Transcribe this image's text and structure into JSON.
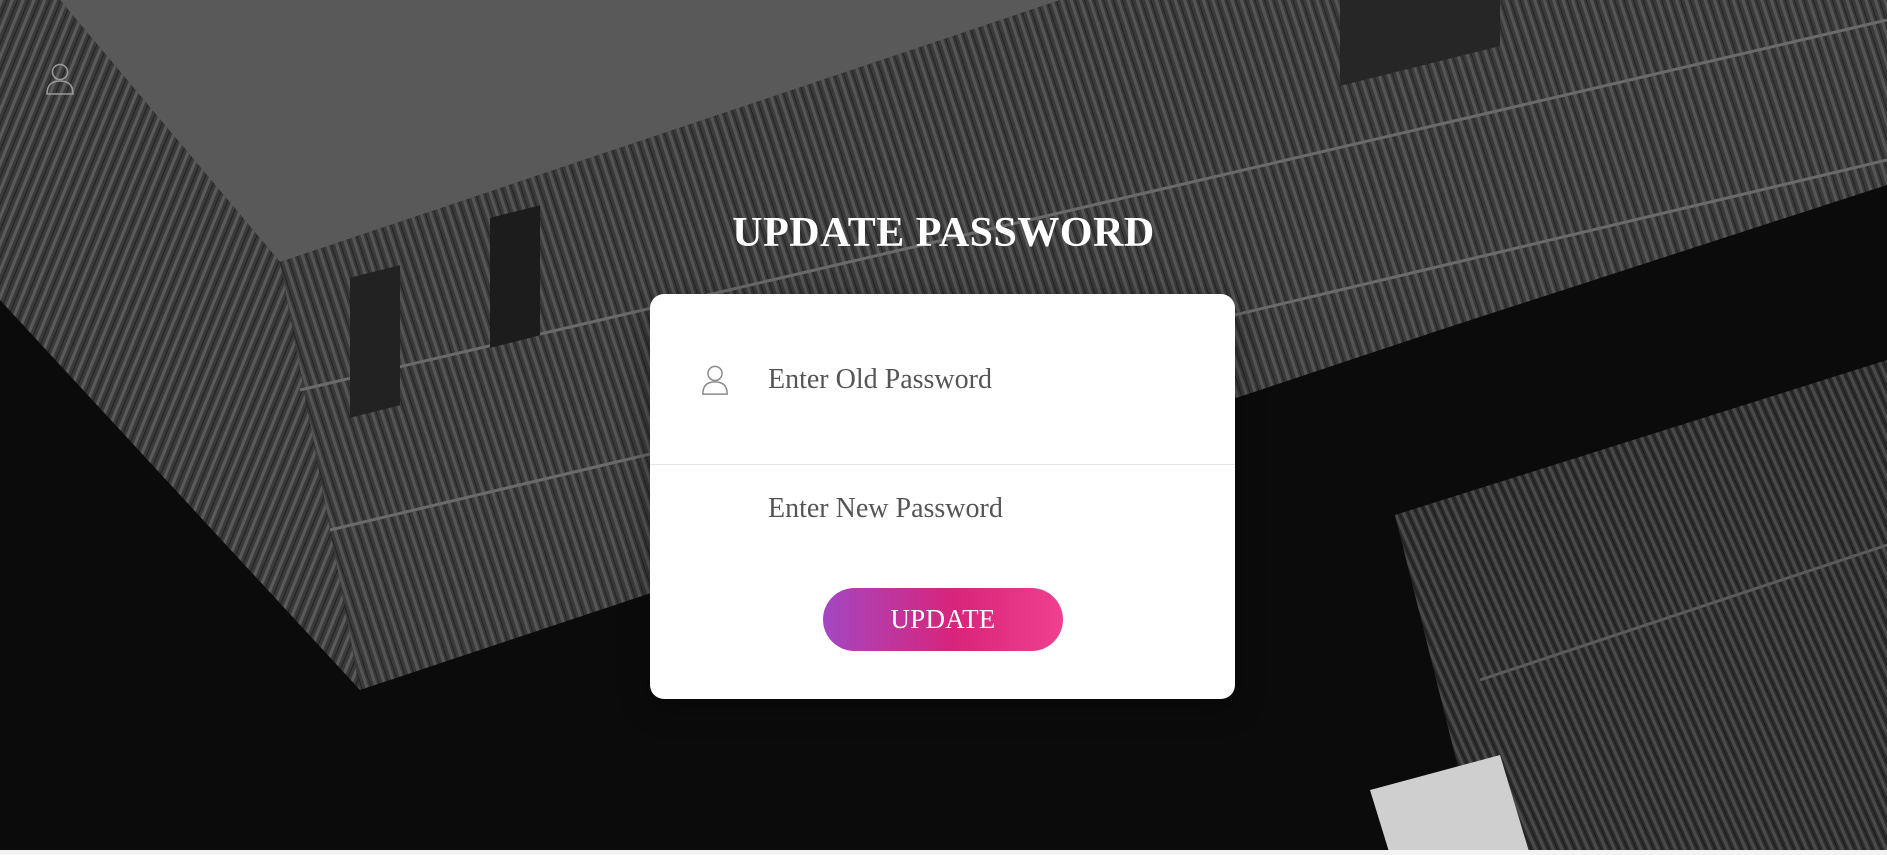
{
  "header": {
    "user_icon": "user-icon"
  },
  "title": "UPDATE PASSWORD",
  "form": {
    "old_password": {
      "icon": "user-icon",
      "placeholder": "Enter Old Password",
      "value": ""
    },
    "new_password": {
      "placeholder": "Enter New Password",
      "value": ""
    },
    "submit_label": "UPDATE"
  },
  "colors": {
    "button_gradient_start": "#a447c2",
    "button_gradient_mid": "#d8247a",
    "button_gradient_end": "#f1408f",
    "card_background": "#ffffff",
    "title_color": "#ffffff"
  }
}
